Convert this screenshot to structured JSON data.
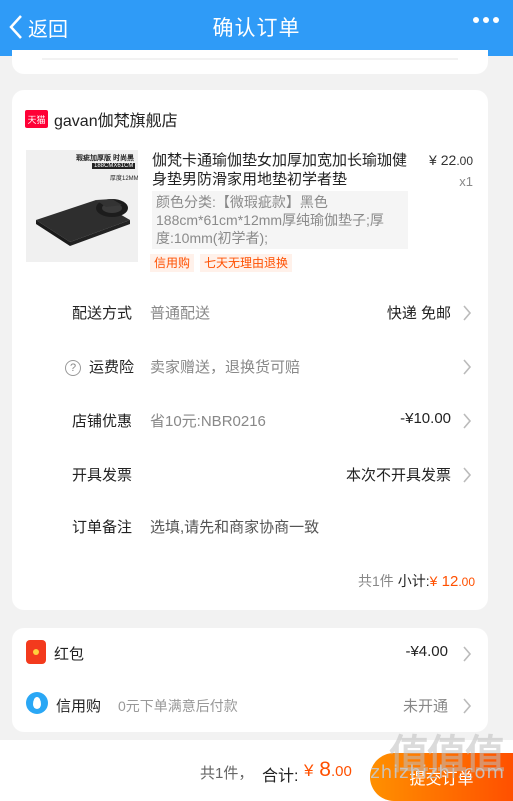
{
  "nav": {
    "back_label": "返回",
    "title": "确认订单"
  },
  "shop": {
    "badge": "天猫",
    "name": "gavan伽梵旗舰店"
  },
  "product": {
    "image_caption_1": "瑕疵加厚版 时尚黑",
    "image_caption_2": "188CMX61CM",
    "image_caption_3": "厚度12MM",
    "title": "伽梵卡通瑜伽垫女加厚加宽加长瑜珈健身垫男防滑家用地垫初学者垫",
    "price_symbol": "¥",
    "price_int": "22",
    "price_dec": ".00",
    "quantity": "x1",
    "sku": "颜色分类:【微瑕疵款】黑色188cm*61cm*12mm厚纯瑜伽垫子;厚度:10mm(初学者);",
    "tags": [
      "信用购",
      "七天无理由退换"
    ]
  },
  "rows": {
    "delivery": {
      "label": "配送方式",
      "value": "普通配送",
      "right": "快递 免邮"
    },
    "insurance": {
      "label": "运费险",
      "value": "卖家赠送，退换货可赔"
    },
    "shop_discount": {
      "label": "店铺优惠",
      "value": "省10元:NBR0216",
      "right": "-¥10.00"
    },
    "invoice": {
      "label": "开具发票",
      "right": "本次不开具发票"
    },
    "note": {
      "label": "订单备注",
      "value": "选填,请先和商家协商一致"
    }
  },
  "subtotal": {
    "count": "共1件",
    "label": "小计:",
    "symbol": "¥",
    "int": " 12",
    "dec": ".00"
  },
  "payment": {
    "hongbao": {
      "label": "红包",
      "right": "-¥4.00"
    },
    "xinyong": {
      "label": "信用购",
      "value": "0元下单满意后付款",
      "right": "未开通"
    }
  },
  "bottom": {
    "count": "共1件，",
    "total_label": "合计:",
    "symbol": "¥",
    "int": " 8",
    "dec": ".00",
    "submit_label": "提交订单"
  },
  "watermark": {
    "chars": "值值值",
    "domain": "zhizhizhi.com"
  },
  "colors": {
    "nav_blue": "#2f9bf7",
    "accent_orange": "#ff5000",
    "tmall_red": "#ff0036"
  }
}
